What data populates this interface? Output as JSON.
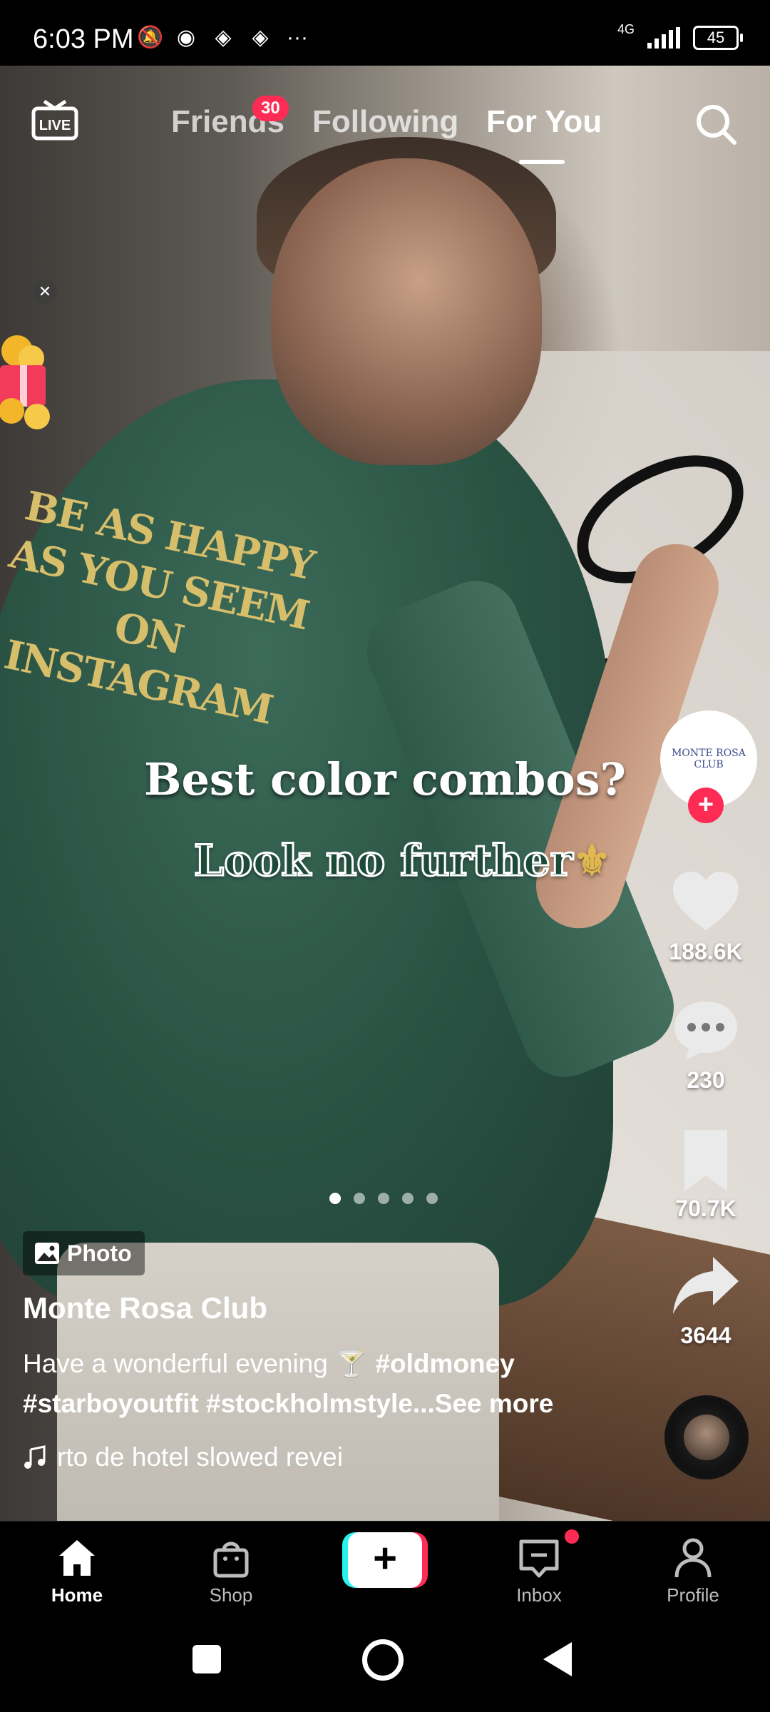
{
  "status_bar": {
    "time": "6:03 PM",
    "network": "4G",
    "battery": "45",
    "overflow": "···"
  },
  "top_nav": {
    "live_label": "LIVE",
    "tabs": [
      {
        "label": "Friends",
        "badge": "30"
      },
      {
        "label": "Following"
      },
      {
        "label": "For You",
        "active": true
      }
    ]
  },
  "post": {
    "shirt_print": "BE AS HAPPY AS YOU SEEM ON INSTAGRAM",
    "caption_line1": "Best color combos?",
    "caption_line2": "Look no further",
    "caption_glyph": "⚜",
    "carousel": {
      "count": 5,
      "current": 1
    },
    "type_chip": "Photo",
    "author": "Monte Rosa Club",
    "avatar_text": "MONTE ROSA CLUB",
    "description_text": "Have a wonderful evening 🍸",
    "hashtags": [
      "#oldmoney",
      "#starboyoutfit",
      "#stockholmstyle"
    ],
    "see_more": "...See more",
    "music": "rto de hotel slowed revei"
  },
  "actions": {
    "likes": "188.6K",
    "comments": "230",
    "saves": "70.7K",
    "shares": "3644"
  },
  "bottom_nav": {
    "items": [
      {
        "label": "Home",
        "icon": "home-icon",
        "active": true
      },
      {
        "label": "Shop",
        "icon": "shopping-bag-icon"
      },
      {
        "label": "",
        "icon": "create-plus-icon"
      },
      {
        "label": "Inbox",
        "icon": "inbox-icon",
        "has_dot": true
      },
      {
        "label": "Profile",
        "icon": "profile-icon"
      }
    ]
  },
  "colors": {
    "accent": "#fe2c55",
    "cyan": "#25f4ee",
    "shirt_green": "#2a5344",
    "print_gold": "#d6be6b"
  }
}
